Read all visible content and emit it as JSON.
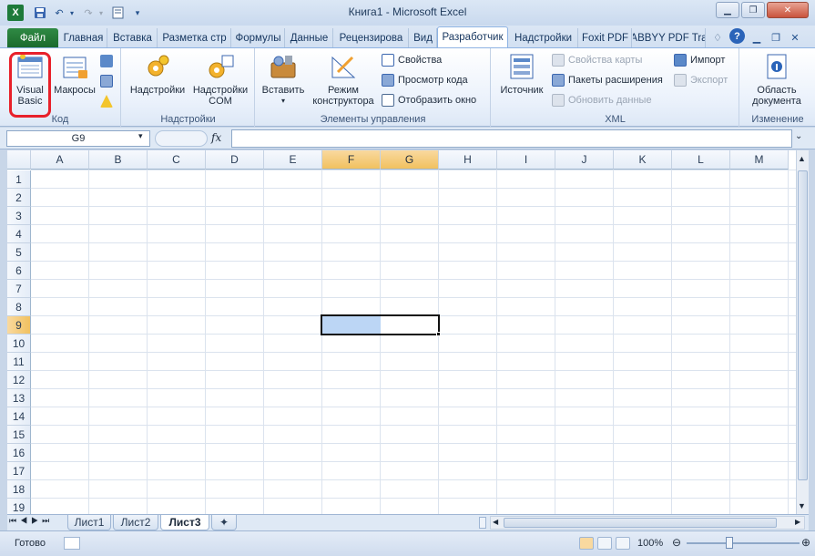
{
  "app": {
    "title": "Книга1  -  Microsoft Excel"
  },
  "tabs": [
    {
      "label": "Файл"
    },
    {
      "label": "Главная"
    },
    {
      "label": "Вставка"
    },
    {
      "label": "Разметка стр"
    },
    {
      "label": "Формулы"
    },
    {
      "label": "Данные"
    },
    {
      "label": "Рецензирова"
    },
    {
      "label": "Вид"
    },
    {
      "label": "Разработчик"
    },
    {
      "label": "Надстройки"
    },
    {
      "label": "Foxit PDF"
    },
    {
      "label": "ABBYY PDF Tra"
    }
  ],
  "ribbon": {
    "code": {
      "label": "Код",
      "visual_basic": "Visual Basic",
      "macros": "Макросы"
    },
    "addins": {
      "label": "Надстройки",
      "addins": "Надстройки",
      "com_addins": "Надстройки COM"
    },
    "controls": {
      "label": "Элементы управления",
      "insert": "Вставить",
      "design_mode": "Режим конструктора",
      "properties": "Свойства",
      "view_code": "Просмотр кода",
      "run_dialog": "Отобразить окно"
    },
    "xml": {
      "label": "XML",
      "source": "Источник",
      "map_props": "Свойства карты",
      "expansion_packs": "Пакеты расширения",
      "refresh_data": "Обновить данные",
      "import": "Импорт",
      "export": "Экспорт"
    },
    "modify": {
      "label": "Изменение",
      "doc_panel": "Область документа"
    }
  },
  "formula_bar": {
    "name_box": "G9",
    "fx": "fx",
    "value": ""
  },
  "grid": {
    "columns": [
      "A",
      "B",
      "C",
      "D",
      "E",
      "F",
      "G",
      "H",
      "I",
      "J",
      "K",
      "L",
      "M"
    ],
    "rows": [
      "1",
      "2",
      "3",
      "4",
      "5",
      "6",
      "7",
      "8",
      "9",
      "10",
      "11",
      "12",
      "13",
      "14",
      "15",
      "16",
      "17",
      "18",
      "19"
    ],
    "active_cell": "G9",
    "selected_columns": [
      "F",
      "G"
    ],
    "selected_row": "9"
  },
  "sheets": [
    {
      "label": "Лист1"
    },
    {
      "label": "Лист2"
    },
    {
      "label": "Лист3"
    }
  ],
  "status": {
    "ready": "Готово",
    "zoom": "100%"
  },
  "colors": {
    "file_tab": "#1b6a2c",
    "selection_header": "#f1c15f",
    "highlight_circle": "#e8202a"
  }
}
